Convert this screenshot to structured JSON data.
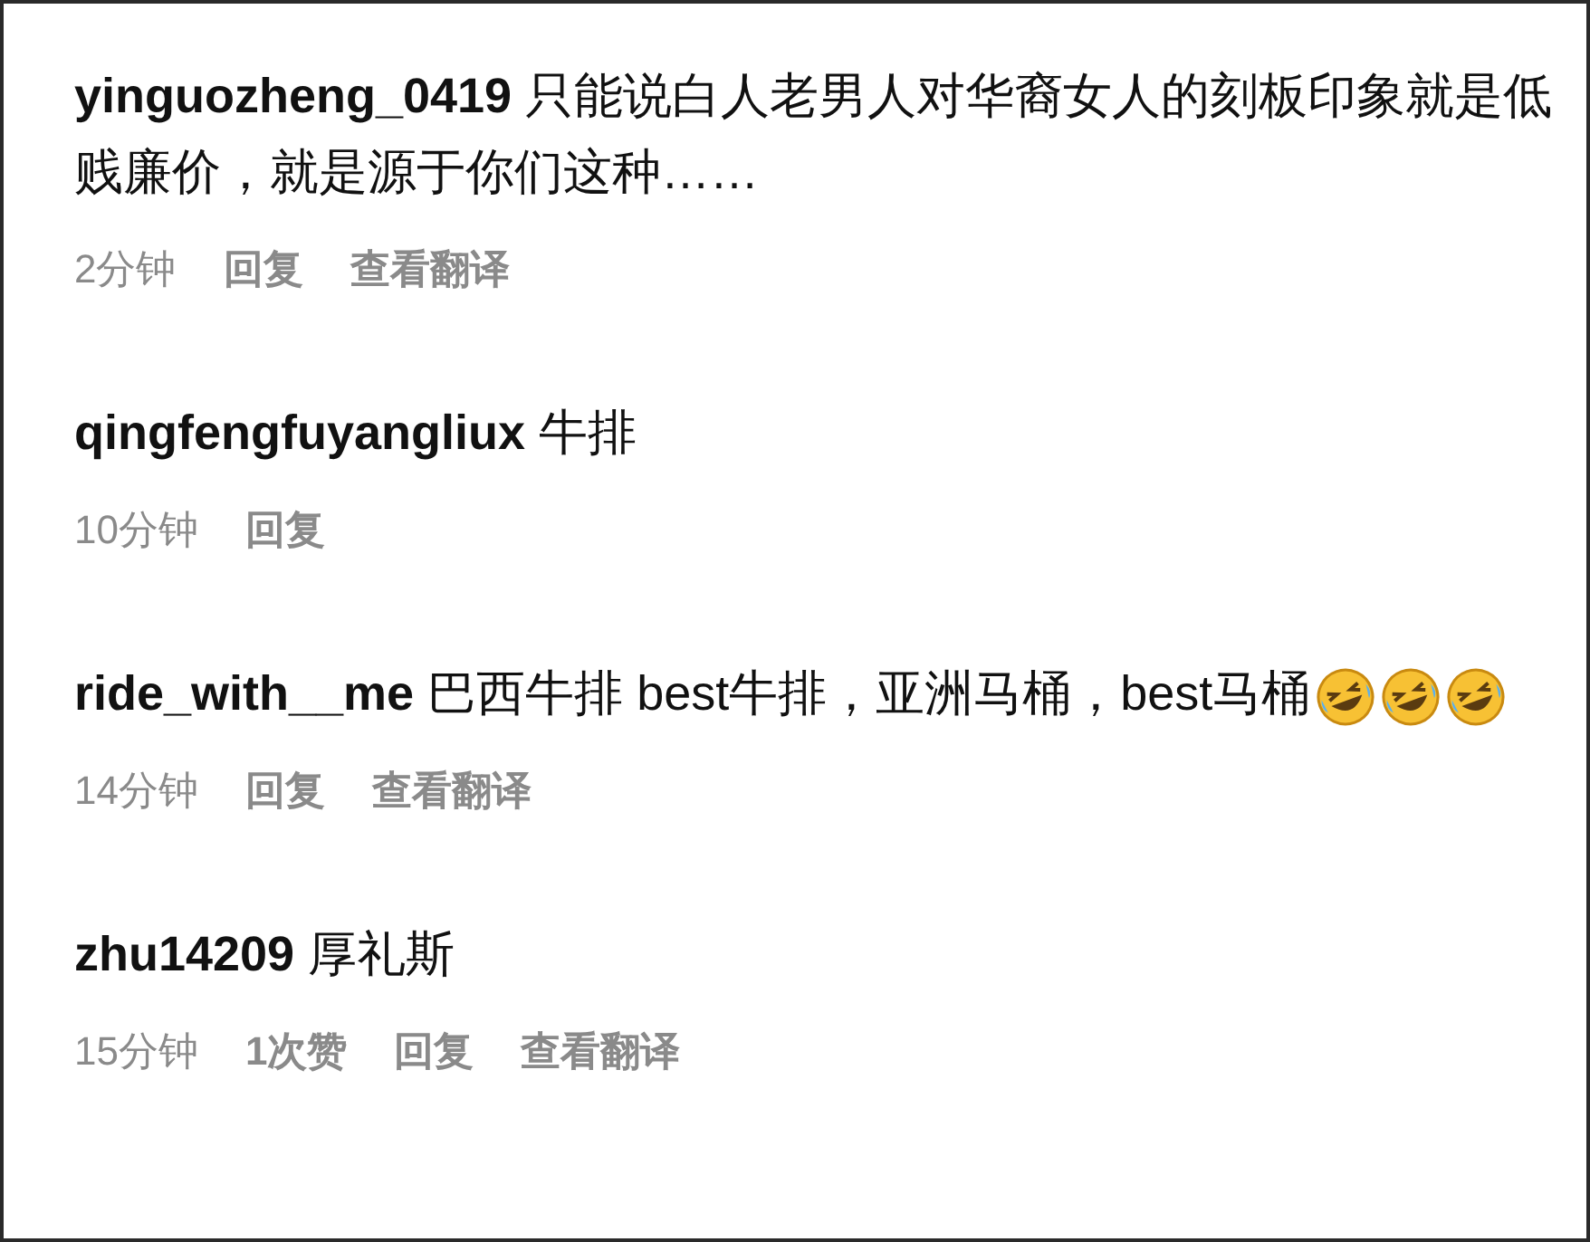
{
  "comments": [
    {
      "username": "yinguozheng_0419",
      "text": "只能说白人老男人对华裔女人的刻板印象就是低贱廉价，就是源于你们这种……",
      "time": "2分钟",
      "actions": [
        "回复",
        "查看翻译"
      ]
    },
    {
      "username": "qingfengfuyangliux",
      "text": "牛排",
      "time": "10分钟",
      "actions": [
        "回复"
      ]
    },
    {
      "username": "ride_with__me",
      "text": "巴西牛排 best牛排，亚洲马桶，best马桶",
      "emojis": [
        {
          "kind": "laughing"
        },
        {
          "kind": "laughing"
        },
        {
          "kind": "laughing"
        }
      ],
      "time": "14分钟",
      "actions": [
        "回复",
        "查看翻译"
      ]
    },
    {
      "username": "zhu14209",
      "text": "厚礼斯",
      "time": "15分钟",
      "actions": [
        "1次赞",
        "回复",
        "查看翻译"
      ]
    }
  ]
}
